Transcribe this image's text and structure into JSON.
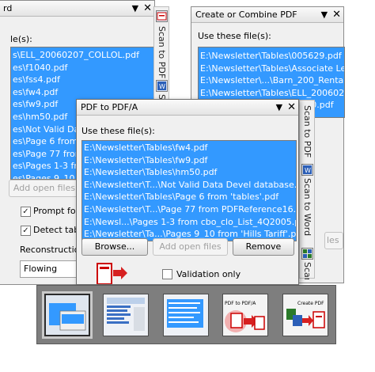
{
  "left_window": {
    "title_fragment": "rd",
    "files_label_fragment": "le(s):",
    "files": [
      "s\\ELL_20060207_COLLOL.pdf",
      "es\\f1040.pdf",
      "es\\fss4.pdf",
      "es\\fw4.pdf",
      "es\\fw9.pdf",
      "es\\hm50.pdf",
      "es\\Not Valid Data Devel",
      "es\\Page 6 from 'tables'",
      "es\\Page 77 from PDFRe",
      "es\\Pages 1-3 from cbo_c",
      "es\\Pages 9_10 from 'Hil"
    ],
    "add_open_files": "Add open files",
    "prompt_label": "Prompt for",
    "detect_label": "Detect tabl",
    "reconstruction_label": "Reconstruction",
    "reconstruction_value": "Flowing",
    "close_glyph": "✕",
    "dropdown_glyph": "▼",
    "check_glyph": "✓"
  },
  "right_window": {
    "title": "Create or Combine PDF",
    "files_label": "Use these file(s):",
    "files": [
      "E:\\Newsletter\\Tables\\005629.pdf",
      "E:\\Newsletter\\Tables\\Associate Ledger.pd",
      "E:\\Newsletter\\...\\Barn_200_Rental_Pricin",
      "E:\\Newsletter\\Tables\\ELL_20060207_COLL",
      "E:\\Newsletter\\Tables\\f1040.pdf"
    ],
    "button_fragment": "les",
    "close_glyph": "✕",
    "dropdown_glyph": "▼"
  },
  "front_window": {
    "title": "PDF to PDF/A",
    "files_label": "Use these file(s):",
    "files": [
      "E:\\Newsletter\\Tables\\fw4.pdf",
      "E:\\Newsletter\\Tables\\fw9.pdf",
      "E:\\Newsletter\\Tables\\hm50.pdf",
      "E:\\Newsletter\\T...\\Not Valid Data Devel database.pdf",
      "E:\\Newsletter\\Tables\\Page 6 from 'tables'.pdf",
      "E:\\Newsletter\\T...\\Page 77 from PDFReference16.pdf",
      "E:\\Newsl...\\Pages 1-3 from cbo_clo_List_4Q2005.pdf",
      "E:\\Newsletter\\Ta...\\Pages 9_10 from 'Hills Tariff'.pdf"
    ],
    "browse": "Browse...",
    "add_open_files": "Add open files",
    "remove": "Remove",
    "validation_only": "Validation only",
    "close_glyph": "✕",
    "dropdown_glyph": "▼"
  },
  "side_tabs_a": [
    "Scan to PDF",
    "Scan to"
  ],
  "side_tabs_b": [
    "Scan to PDF",
    "Scan to Word",
    "Scan"
  ],
  "thumbnails": {
    "selected_index": 0,
    "pdf_to_pdfa_caption": "PDF to PDF/A",
    "create_pdf_caption": "Create PDF"
  }
}
